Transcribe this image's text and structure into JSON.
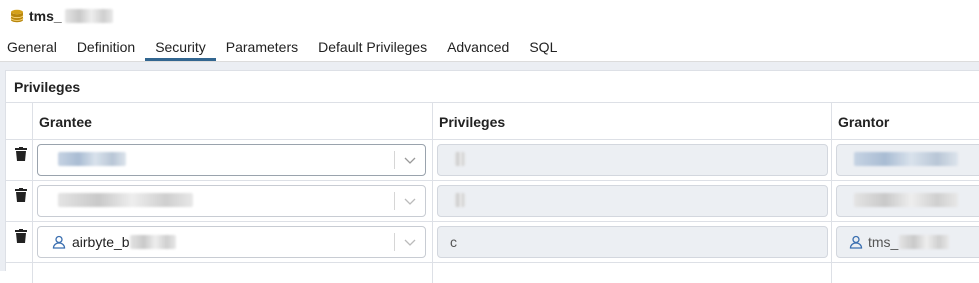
{
  "window": {
    "title": "tms_",
    "icon": "database-icon"
  },
  "tabs": [
    {
      "label": "General",
      "active": false
    },
    {
      "label": "Definition",
      "active": false
    },
    {
      "label": "Security",
      "active": true
    },
    {
      "label": "Parameters",
      "active": false
    },
    {
      "label": "Default Privileges",
      "active": false
    },
    {
      "label": "Advanced",
      "active": false
    },
    {
      "label": "SQL",
      "active": false
    }
  ],
  "privileges": {
    "section_title": "Privileges",
    "columns": [
      "Grantee",
      "Privileges",
      "Grantor"
    ],
    "rows": [
      {
        "grantee": "",
        "privileges": "",
        "grantor": ""
      },
      {
        "grantee": "",
        "privileges": "",
        "grantor": ""
      },
      {
        "grantee": "airbyte_b",
        "privileges": "c",
        "grantor": "tms_"
      }
    ]
  },
  "colors": {
    "accent": "#326690",
    "panel_bg": "#ebeef3",
    "border": "#dde0e6"
  }
}
